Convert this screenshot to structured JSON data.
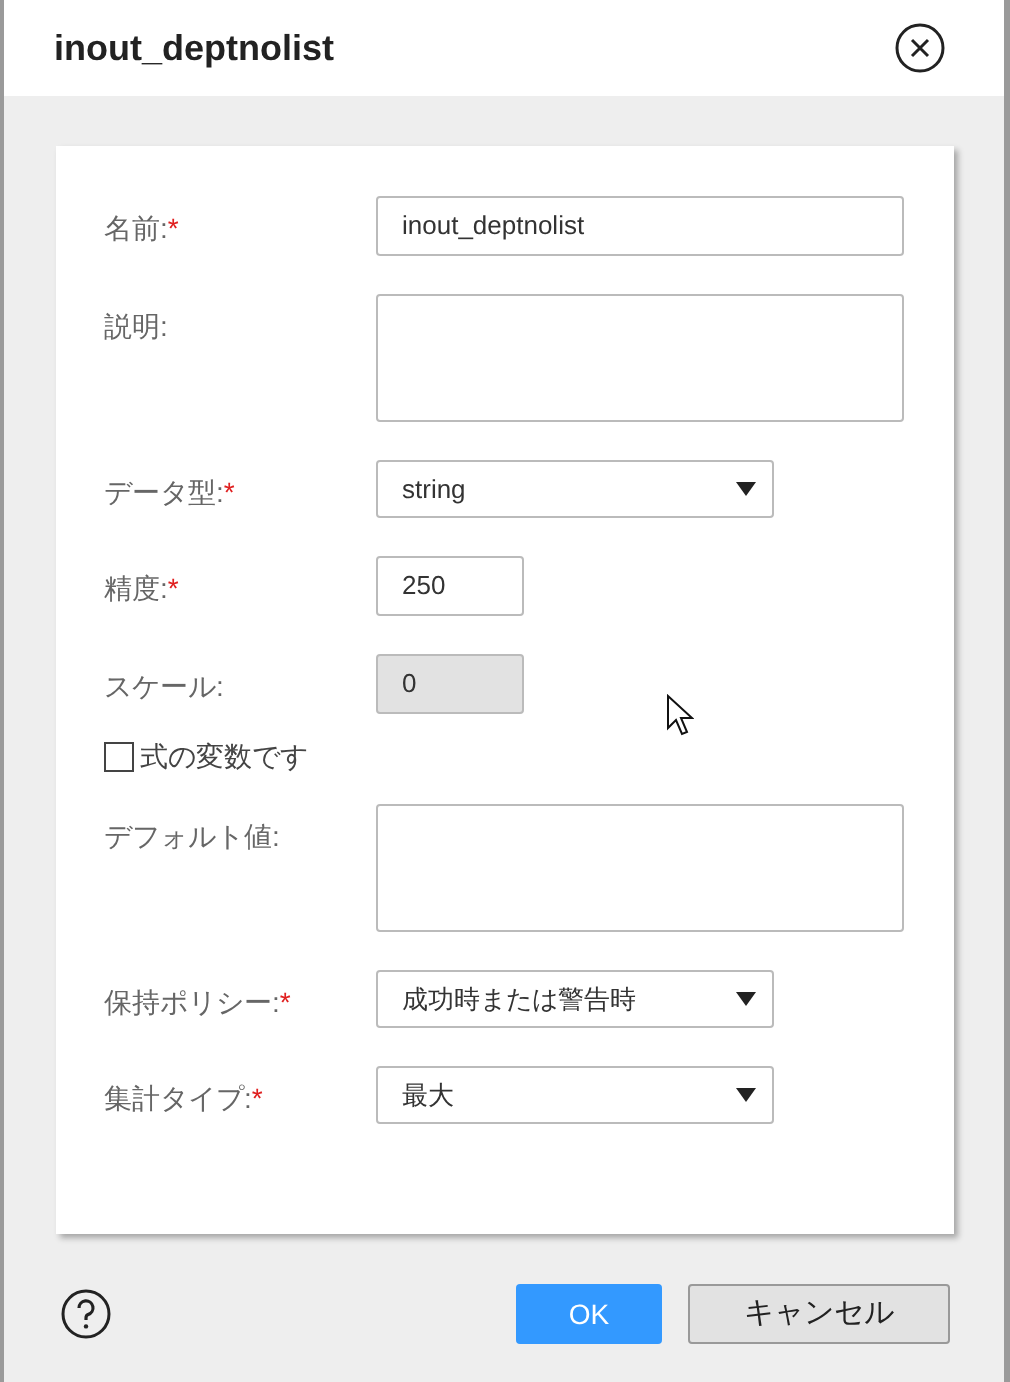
{
  "dialog": {
    "title": "inout_deptnolist"
  },
  "fields": [
    {
      "kind": "text",
      "label": "名前:",
      "required_mark": "*",
      "value": "inout_deptnolist",
      "disabled": false
    },
    {
      "kind": "textarea",
      "label": "説明:"
    },
    {
      "kind": "select",
      "label": "データ型:",
      "required_mark": "*",
      "value": "string"
    },
    {
      "kind": "number",
      "label": "精度:",
      "required_mark": "*",
      "value": "250",
      "disabled": false
    },
    {
      "kind": "number",
      "label": "スケール:",
      "value": "0",
      "disabled": true
    },
    {
      "kind": "checkbox",
      "label": "式の変数です",
      "checked": false
    },
    {
      "kind": "textarea",
      "label": "デフォルト値:"
    },
    {
      "kind": "select",
      "label": "保持ポリシー:",
      "required_mark": "*",
      "value": "成功時または警告時"
    },
    {
      "kind": "select",
      "label": "集計タイプ:",
      "required_mark": "*",
      "value": "最大"
    }
  ],
  "buttons": [
    {
      "label": "OK",
      "primary": true
    },
    {
      "label": "キャンセル",
      "primary": false
    }
  ]
}
